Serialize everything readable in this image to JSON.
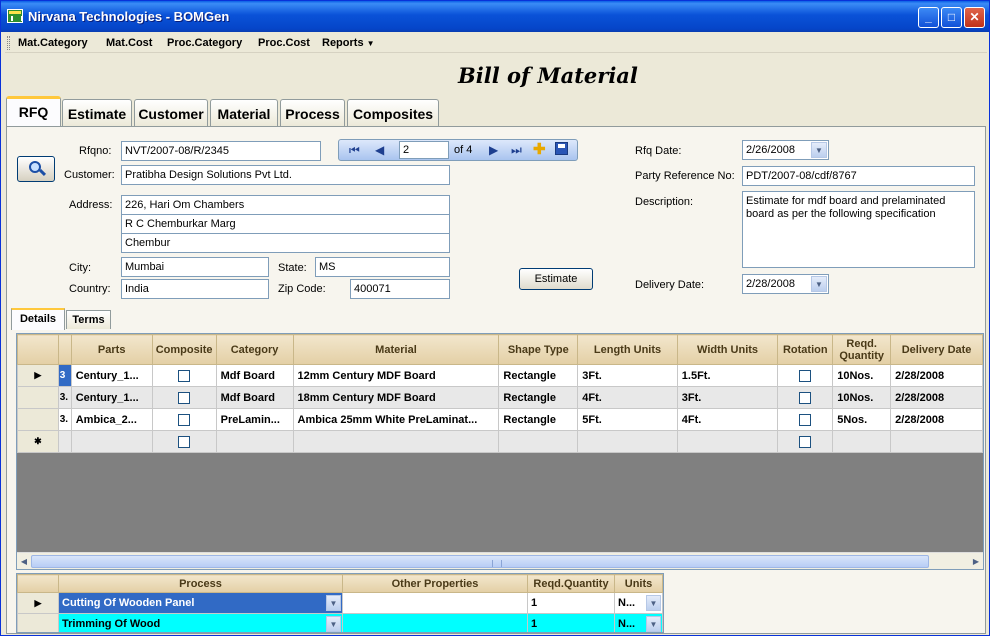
{
  "window": {
    "title": "Nirvana Technologies - BOMGen"
  },
  "menu": [
    "Mat.Category",
    "Mat.Cost",
    "Proc.Category",
    "Proc.Cost",
    "Reports"
  ],
  "heading": "Bill of Material",
  "tabs": [
    "RFQ",
    "Estimate",
    "Customer",
    "Material",
    "Process",
    "Composites"
  ],
  "form": {
    "rfqno_label": "Rfqno:",
    "rfqno": "NVT/2007-08/R/2345",
    "customer_label": "Customer:",
    "customer": "Pratibha Design Solutions Pvt Ltd.",
    "address_label": "Address:",
    "address": [
      "226, Hari Om Chambers",
      "R C Chemburkar Marg",
      "Chembur"
    ],
    "city_label": "City:",
    "city": "Mumbai",
    "state_label": "State:",
    "state": "MS",
    "country_label": "Country:",
    "country": "India",
    "zip_label": "Zip Code:",
    "zip": "400071",
    "estimate_button": "Estimate",
    "rfq_date_label": "Rfq Date:",
    "rfq_date": "2/26/2008",
    "party_ref_label": "Party Reference No:",
    "party_ref": "PDT/2007-08/cdf/8767",
    "description_label": "Description:",
    "description": "Estimate for mdf board and prelaminated board as per the following specification",
    "delivery_date_label": "Delivery Date:",
    "delivery_date": "2/28/2008"
  },
  "navigator": {
    "position": "2",
    "of": "of 4"
  },
  "subtabs": [
    "Details",
    "Terms"
  ],
  "details_grid": {
    "columns": [
      "Parts",
      "Composite",
      "Category",
      "Material",
      "Shape Type",
      "Length Units",
      "Width Units",
      "Rotation",
      "Reqd. Quantity",
      "Delivery Date"
    ],
    "rows": [
      {
        "marker": "▶",
        "idx": "3",
        "parts": "Century_1...",
        "category": "Mdf Board",
        "material": "12mm Century MDF Board",
        "shape": "Rectangle",
        "length": "3Ft.",
        "width": "1.5Ft.",
        "qty": "10Nos.",
        "delivery": "2/28/2008"
      },
      {
        "marker": "",
        "idx": "3.",
        "parts": "Century_1...",
        "category": "Mdf Board",
        "material": "18mm Century MDF Board",
        "shape": "Rectangle",
        "length": "4Ft.",
        "width": "3Ft.",
        "qty": "10Nos.",
        "delivery": "2/28/2008"
      },
      {
        "marker": "",
        "idx": "3.",
        "parts": "Ambica_2...",
        "category": "PreLamin...",
        "material": "Ambica 25mm White PreLaminat...",
        "shape": "Rectangle",
        "length": "5Ft.",
        "width": "4Ft.",
        "qty": "5Nos.",
        "delivery": "2/28/2008"
      }
    ],
    "new_row_marker": "✱"
  },
  "process_grid": {
    "columns": [
      "Process",
      "Other Properties",
      "Reqd.Quantity",
      "Units"
    ],
    "rows": [
      {
        "marker": "▶",
        "process": "Cutting Of Wooden Panel",
        "other": "",
        "qty": "1",
        "units": "N..."
      },
      {
        "marker": "",
        "process": "Trimming Of Wood",
        "other": "",
        "qty": "1",
        "units": "N..."
      }
    ]
  }
}
